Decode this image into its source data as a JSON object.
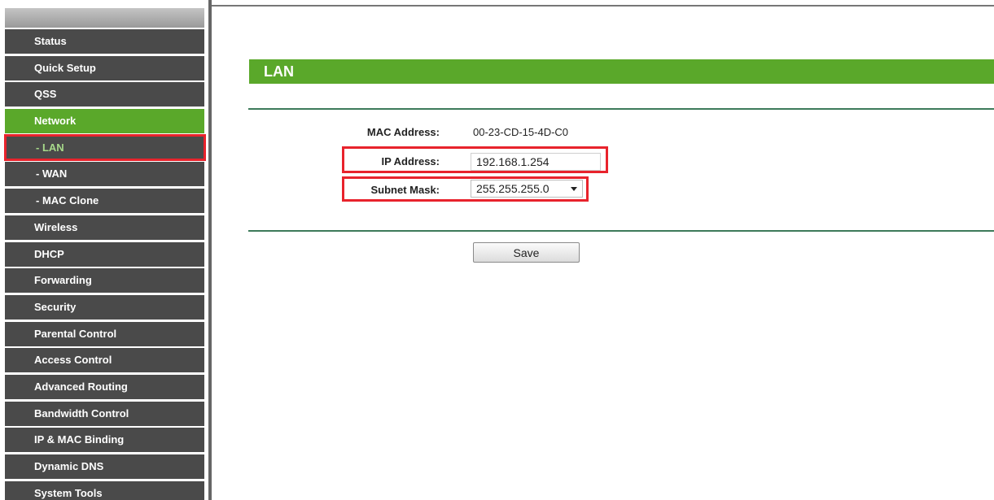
{
  "sidebar": {
    "items": [
      {
        "label": "Status"
      },
      {
        "label": "Quick Setup"
      },
      {
        "label": "QSS"
      },
      {
        "label": "Network"
      },
      {
        "label": "- LAN"
      },
      {
        "label": "- WAN"
      },
      {
        "label": "- MAC Clone"
      },
      {
        "label": "Wireless"
      },
      {
        "label": "DHCP"
      },
      {
        "label": "Forwarding"
      },
      {
        "label": "Security"
      },
      {
        "label": "Parental Control"
      },
      {
        "label": "Access Control"
      },
      {
        "label": "Advanced Routing"
      },
      {
        "label": "Bandwidth Control"
      },
      {
        "label": "IP & MAC Binding"
      },
      {
        "label": "Dynamic DNS"
      },
      {
        "label": "System Tools"
      }
    ]
  },
  "main": {
    "title": "LAN",
    "mac": {
      "label": "MAC Address:",
      "value": "00-23-CD-15-4D-C0"
    },
    "ip": {
      "label": "IP Address:",
      "value": "192.168.1.254"
    },
    "subnet": {
      "label": "Subnet Mask:",
      "value": "255.255.255.0"
    },
    "save_label": "Save"
  },
  "colors": {
    "accent_green": "#5aa82a",
    "sidebar_bg": "#4a4a4a",
    "highlight_red": "#e8232c"
  }
}
